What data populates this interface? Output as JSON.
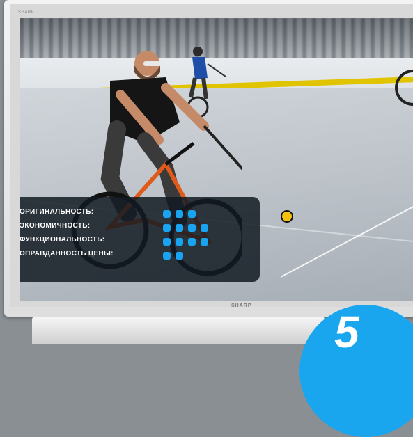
{
  "monitor": {
    "brand_small": "SHARP",
    "brand_bottom": "SHARP"
  },
  "rating": {
    "items": [
      {
        "label": "ОРИГИНАЛЬНОСТЬ:",
        "dots": 3
      },
      {
        "label": "ЭКОНОМИЧНОСТЬ:",
        "dots": 4
      },
      {
        "label": "ФУНКЦИОНАЛЬНОСТЬ:",
        "dots": 4
      },
      {
        "label": "ОПРАВДАННОСТЬ ЦЕНЫ:",
        "dots": 2
      }
    ]
  },
  "badge": {
    "number": "5"
  },
  "colors": {
    "accent": "#18a4f0",
    "panel": "#121a22"
  },
  "icons": [
    "bicycle-illustration",
    "mallet-illustration"
  ]
}
